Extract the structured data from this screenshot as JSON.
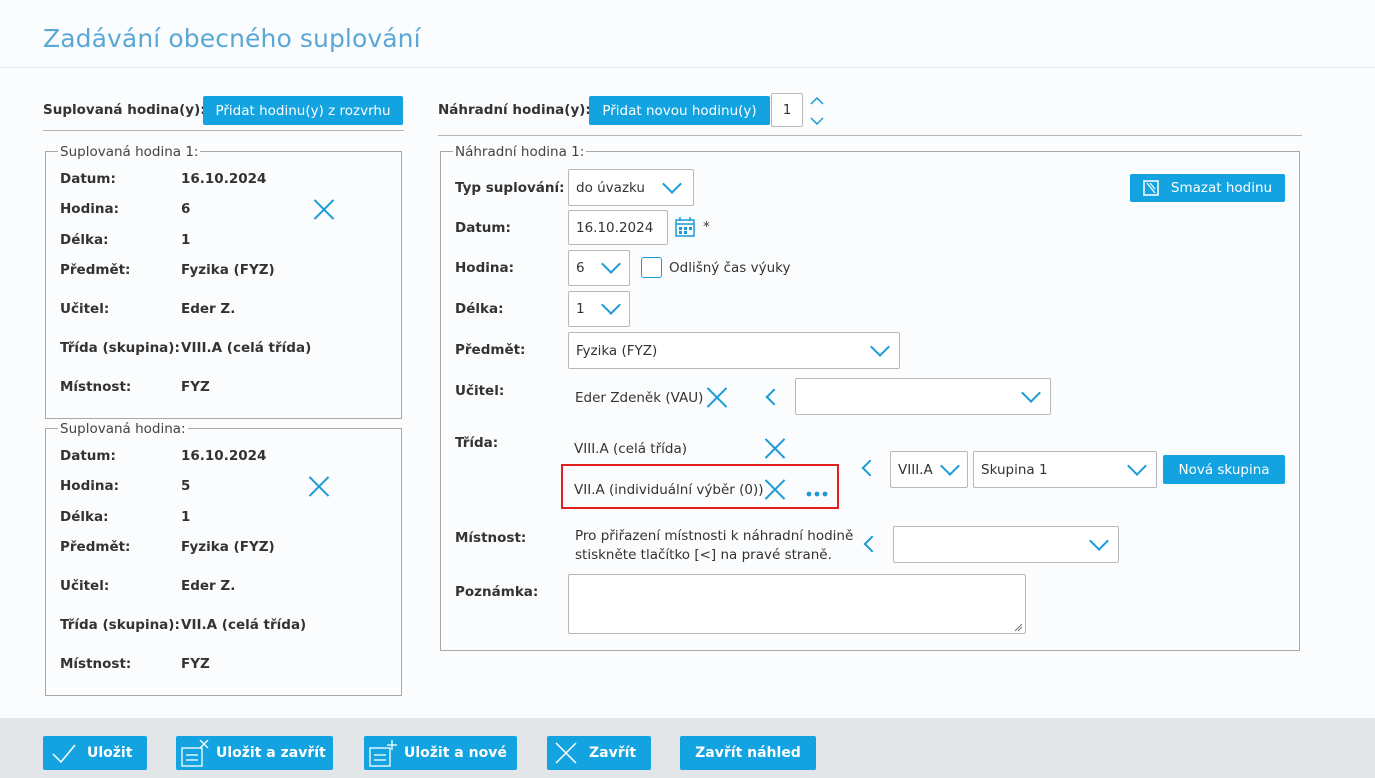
{
  "page": {
    "title": "Zadávání obecného suplování"
  },
  "left": {
    "header_label": "Suplovaná hodina(y):",
    "add_button": "Přidat hodinu(y) z rozvrhu",
    "cards": [
      {
        "legend": "Suplovaná hodina 1:",
        "rows": [
          {
            "label": "Datum:",
            "value": "16.10.2024"
          },
          {
            "label": "Hodina:",
            "value": "6"
          },
          {
            "label": "Délka:",
            "value": "1"
          },
          {
            "label": "Předmět:",
            "value": "Fyzika (FYZ)"
          },
          {
            "label": "Učitel:",
            "value": "Eder Z."
          },
          {
            "label": "Třída (skupina):",
            "value": "VIII.A (celá třída)"
          },
          {
            "label": "Místnost:",
            "value": "FYZ"
          }
        ]
      },
      {
        "legend": "Suplovaná hodina:",
        "rows": [
          {
            "label": "Datum:",
            "value": "16.10.2024"
          },
          {
            "label": "Hodina:",
            "value": "5"
          },
          {
            "label": "Délka:",
            "value": "1"
          },
          {
            "label": "Předmět:",
            "value": "Fyzika (FYZ)"
          },
          {
            "label": "Učitel:",
            "value": "Eder Z."
          },
          {
            "label": "Třída (skupina):",
            "value": "VII.A (celá třída)"
          },
          {
            "label": "Místnost:",
            "value": "FYZ"
          }
        ]
      }
    ]
  },
  "right": {
    "header_label": "Náhradní hodina(y):",
    "new_button": "Přidat novou hodinu(y)",
    "count_value": "1",
    "legend": "Náhradní hodina 1:",
    "delete_button": "Smazat hodinu",
    "typ_label": "Typ suplování:",
    "typ_value": "do úvazku",
    "datum_label": "Datum:",
    "datum_value": "16.10.2024",
    "required_mark": "*",
    "hodina_label": "Hodina:",
    "hodina_value": "6",
    "odlisny_label": "Odlišný čas výuky",
    "delka_label": "Délka:",
    "delka_value": "1",
    "predmet_label": "Předmět:",
    "predmet_value": "Fyzika (FYZ)",
    "ucitel_label": "Učitel:",
    "ucitel_value": "Eder Zdeněk (VAU)",
    "ucitel_select": "",
    "trida_label": "Třída:",
    "trida_items": [
      "VIII.A (celá třída)",
      "VII.A (individuální výběr (0))"
    ],
    "trida_class_select": "VIII.A",
    "trida_group_select": "Skupina 1",
    "new_group_button": "Nová skupina",
    "mistnost_label": "Místnost:",
    "mistnost_hint_1": "Pro přiřazení místnosti k náhradní hodině",
    "mistnost_hint_2": "stiskněte tlačítko [<] na pravé straně.",
    "mistnost_select": "",
    "poznamka_label": "Poznámka:",
    "poznamka_value": ""
  },
  "footer": {
    "save": "Uložit",
    "save_close": "Uložit a zavřít",
    "save_new": "Uložit a nové",
    "close": "Zavřít",
    "close_preview": "Zavřít náhled"
  },
  "colors": {
    "accent": "#12a3e0",
    "icon": "#1a9bd7",
    "highlight": "#e02020",
    "title": "#5aa8d6"
  }
}
